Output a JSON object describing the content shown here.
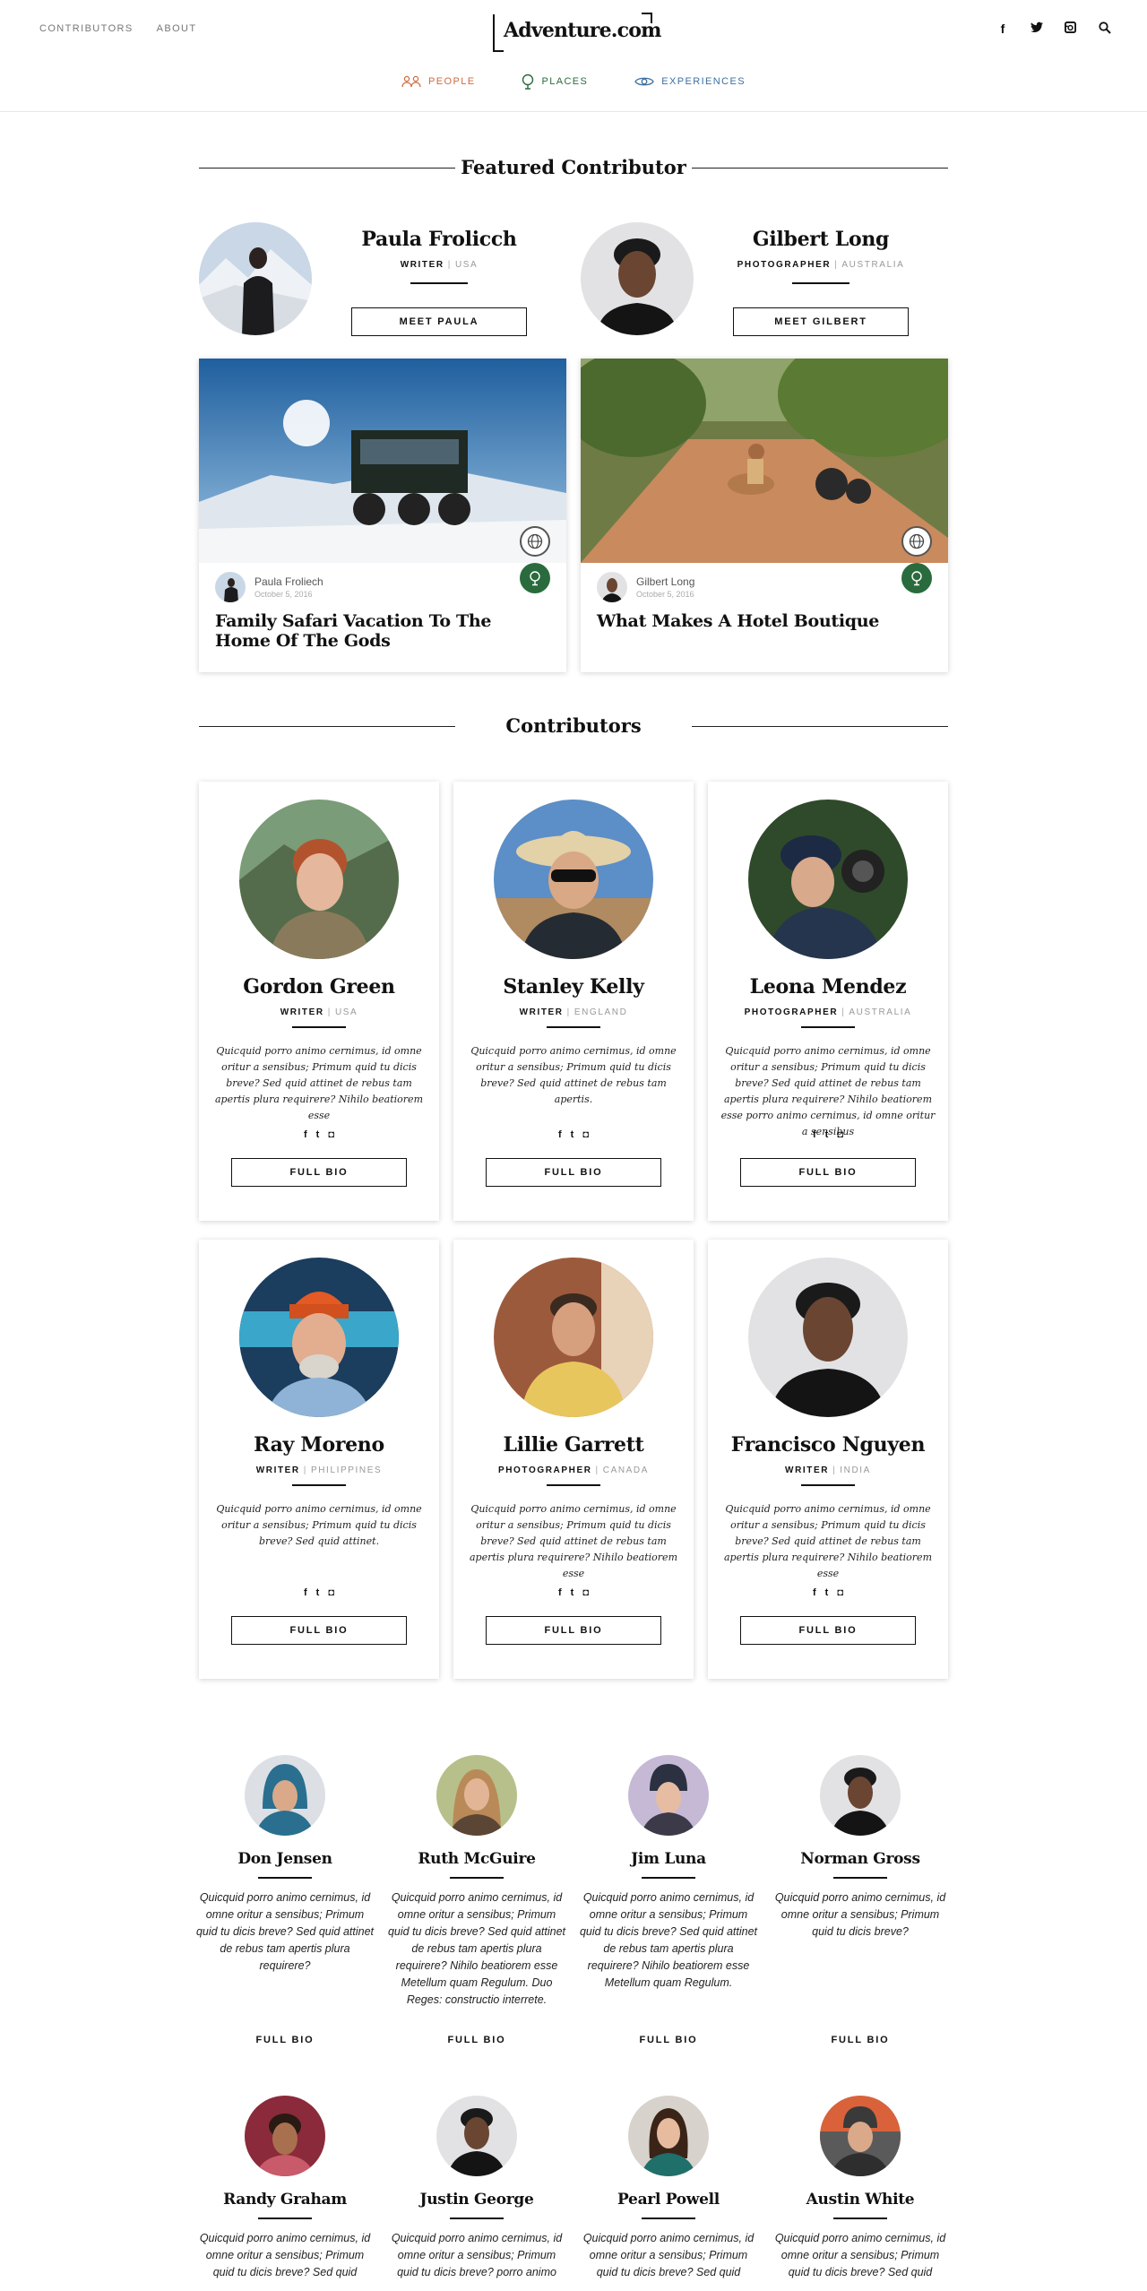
{
  "header": {
    "nav": [
      "CONTRIBUTORS",
      "ABOUT"
    ],
    "logo": "Adventure.com",
    "social_icons": [
      "facebook-icon",
      "twitter-icon",
      "instagram-icon",
      "search-icon"
    ],
    "categories": [
      {
        "label": "PEOPLE",
        "icon": "people-icon",
        "color": "#cf6a3c"
      },
      {
        "label": "PLACES",
        "icon": "globe-pin-icon",
        "color": "#2a6b3d"
      },
      {
        "label": "EXPERIENCES",
        "icon": "eye-icon",
        "color": "#3e6fa0"
      }
    ]
  },
  "featured": {
    "title": "Featured Contributor",
    "people": [
      {
        "name": "Paula Frolicch",
        "role": "WRITER",
        "location": "USA",
        "button": "MEET PAULA"
      },
      {
        "name": "Gilbert Long",
        "role": "PHOTOGRAPHER",
        "location": "AUSTRALIA",
        "button": "MEET GILBERT"
      }
    ],
    "articles": [
      {
        "author": "Paula Froliech",
        "date": "October 5, 2016",
        "title": "Family Safari Vacation To The Home Of The Gods"
      },
      {
        "author": "Gilbert Long",
        "date": "October 5, 2016",
        "title": "What Makes A Hotel Boutique"
      }
    ]
  },
  "contributors": {
    "title": "Contributors",
    "button": "FULL BIO",
    "cards": [
      {
        "name": "Gordon Green",
        "role": "WRITER",
        "location": "USA",
        "bio": "Quicquid porro animo cernimus, id omne oritur a sensibus; Primum quid tu dicis breve? Sed quid attinet de rebus tam apertis plura requirere? Nihilo beatiorem esse"
      },
      {
        "name": "Stanley Kelly",
        "role": "WRITER",
        "location": "ENGLAND",
        "bio": "Quicquid porro animo cernimus, id omne oritur a sensibus; Primum quid tu dicis breve? Sed quid attinet de rebus tam apertis."
      },
      {
        "name": "Leona Mendez",
        "role": "PHOTOGRAPHER",
        "location": "AUSTRALIA",
        "bio": "Quicquid porro animo cernimus, id omne oritur a sensibus; Primum quid tu dicis breve? Sed quid attinet de rebus tam apertis plura requirere? Nihilo beatiorem esse porro animo cernimus, id omne oritur a sensibus"
      },
      {
        "name": "Ray Moreno",
        "role": "WRITER",
        "location": "PHILIPPINES",
        "bio": "Quicquid porro animo cernimus, id omne oritur a sensibus; Primum quid tu dicis breve? Sed quid attinet."
      },
      {
        "name": "Lillie Garrett",
        "role": "PHOTOGRAPHER",
        "location": "CANADA",
        "bio": "Quicquid porro animo cernimus, id omne oritur a sensibus; Primum quid tu dicis breve? Sed quid attinet de rebus tam apertis plura requirere? Nihilo beatiorem esse"
      },
      {
        "name": "Francisco Nguyen",
        "role": "WRITER",
        "location": "INDIA",
        "bio": "Quicquid porro animo cernimus, id omne oritur a sensibus; Primum quid tu dicis breve? Sed quid attinet de rebus tam apertis plura requirere? Nihilo beatiorem esse"
      }
    ]
  },
  "more": {
    "button": "FULL BIO",
    "people": [
      {
        "name": "Don Jensen",
        "bio": "Quicquid porro animo cernimus, id omne oritur a sensibus; Primum quid tu dicis breve? Sed quid attinet de rebus tam apertis plura requirere?"
      },
      {
        "name": "Ruth McGuire",
        "bio": "Quicquid porro animo cernimus, id omne oritur a sensibus; Primum quid tu dicis breve? Sed quid attinet de rebus tam apertis plura requirere? Nihilo beatiorem esse Metellum quam Regulum. Duo Reges: constructio interrete."
      },
      {
        "name": "Jim Luna",
        "bio": "Quicquid porro animo cernimus, id omne oritur a sensibus; Primum quid tu dicis breve? Sed quid attinet de rebus tam apertis plura requirere? Nihilo beatiorem esse Metellum quam Regulum."
      },
      {
        "name": "Norman Gross",
        "bio": "Quicquid porro animo cernimus, id omne oritur a sensibus; Primum quid tu dicis breve?"
      },
      {
        "name": "Randy Graham",
        "bio": "Quicquid porro animo cernimus, id omne oritur a sensibus; Primum quid tu dicis breve? Sed quid"
      },
      {
        "name": "Justin George",
        "bio": "Quicquid porro animo cernimus, id omne oritur a sensibus; Primum quid tu dicis breve? porro animo"
      },
      {
        "name": "Pearl Powell",
        "bio": "Quicquid porro animo cernimus, id omne oritur a sensibus; Primum quid tu dicis breve? Sed quid"
      },
      {
        "name": "Austin White",
        "bio": "Quicquid porro animo cernimus, id omne oritur a sensibus; Primum quid tu dicis breve? Sed quid"
      }
    ]
  }
}
